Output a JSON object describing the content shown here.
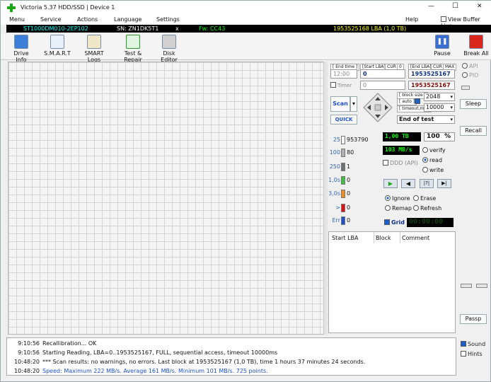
{
  "window": {
    "title": "Victoria 5.37 HDD/SSD | Device 1",
    "minimize": "—",
    "maximize": "☐",
    "close": "✕"
  },
  "menu": {
    "items": [
      "Menu",
      "Service",
      "Actions",
      "Language",
      "Settings"
    ],
    "help": "Help",
    "view_buffer": "View Buffer Live"
  },
  "drive_info": {
    "model": "ST1000DM010-2EP102",
    "serial": "SN: ZN1DK5T1",
    "close": "x",
    "firmware": "Fw: CC43",
    "capacity": "1953525168 LBA (1,0 TB)"
  },
  "toolbar": {
    "buttons": [
      "Drive Info",
      "S.M.A.R.T",
      "SMART Logs",
      "Test & Repair",
      "Disk Editor"
    ],
    "pause": "Pause",
    "break_all": "Break All"
  },
  "test_panel": {
    "end_time_label": "[ End time ]",
    "end_time_value": "12:00",
    "timer_label": "Timer",
    "timer_value": "0",
    "start_lba_label": "[Start LBA]",
    "cur_label": "CUR",
    "cur_value": "0",
    "start_lba_value": "0",
    "end_lba_label": "[End LBA]",
    "cur2_label": "CUR",
    "max_label": "MAX",
    "end_lba_value": "1953525167",
    "end_lba_current": "1953525167",
    "block_size_label": "[ block size ]",
    "auto_label": "[ auto ]",
    "timeout_label": "[ timeout,ms ]",
    "block_size_value": "2048",
    "timeout_value": "10000",
    "scan_button": "Scan",
    "quick_button": "QUICK",
    "end_of_test": "End of test"
  },
  "stats": [
    {
      "label": "25",
      "count": "953790",
      "color": "#f4f4f4"
    },
    {
      "label": "100",
      "count": "80",
      "color": "#b0b0b0"
    },
    {
      "label": "250",
      "count": "1",
      "color": "#707070"
    },
    {
      "label": "1,0s",
      "count": "0",
      "color": "#3cc23c"
    },
    {
      "label": "3,0s",
      "count": "0",
      "color": "#f08c1c"
    },
    {
      "label": ">",
      "count": "0",
      "color": "#e01010"
    },
    {
      "label": "Err",
      "count": "0",
      "color": "#1b4fd1"
    }
  ],
  "readouts": {
    "size": "1,00 TB",
    "percent": "100",
    "percent_unit": "%",
    "speed": "103 MB/s",
    "ddd_api": "DDD (API)",
    "timer": "00:00:00"
  },
  "modes": {
    "verify": "verify",
    "read": "read",
    "write": "write"
  },
  "repair": {
    "ignore": "Ignore",
    "erase": "Erase",
    "remap": "Remap",
    "refresh": "Refresh",
    "grid": "Grid"
  },
  "playback": {
    "play": "▶",
    "back": "◀",
    "skip_back": "|?|",
    "skip_end": "▶|"
  },
  "table": {
    "columns": [
      "Start LBA",
      "Block",
      "Comment"
    ]
  },
  "right_panel": {
    "api": "API",
    "pio": "PIO",
    "sleep": "Sleep",
    "recall": "Recall",
    "passp": "Passp",
    "sound": "Sound",
    "hints": "Hints"
  },
  "log": [
    {
      "time": "9:10:56",
      "msg": "Recallibration... OK",
      "color": "#000000"
    },
    {
      "time": "9:10:56",
      "msg": "Starting Reading, LBA=0..1953525167, FULL, sequential access, timeout 10000ms",
      "color": "#000000"
    },
    {
      "time": "10:48:20",
      "msg": "*** Scan results: no warnings, no errors. Last block at 1953525167 (1,0 TB), time 1 hours 37 minutes 24 seconds.",
      "color": "#000000"
    },
    {
      "time": "10:48:20",
      "msg": "Speed: Maximum 222 MB/s. Average 161 MB/s. Minimum 101 MB/s. 725 points.",
      "color": "#1b4fd1"
    }
  ],
  "colors": {
    "accent": "#1b61c9",
    "digit_green": "#00ff00",
    "info_cyan": "#00ffff",
    "window_bg": "#f0f0f0"
  }
}
